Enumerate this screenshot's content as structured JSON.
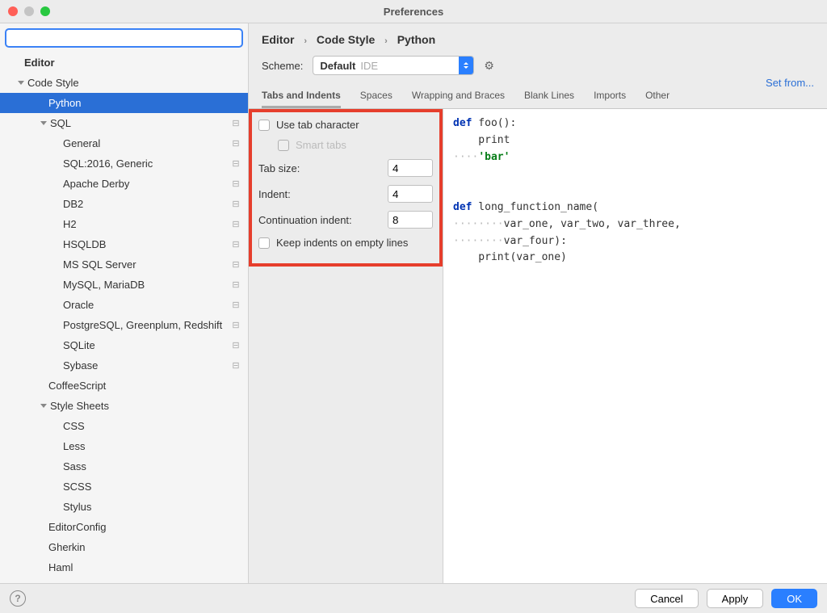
{
  "window": {
    "title": "Preferences"
  },
  "search": {
    "placeholder": ""
  },
  "tree": {
    "root": "Editor",
    "codestyle": "Code Style",
    "python": "Python",
    "sql": "SQL",
    "sql_items": [
      "General",
      "SQL:2016, Generic",
      "Apache Derby",
      "DB2",
      "H2",
      "HSQLDB",
      "MS SQL Server",
      "MySQL, MariaDB",
      "Oracle",
      "PostgreSQL, Greenplum, Redshift",
      "SQLite",
      "Sybase"
    ],
    "coffeescript": "CoffeeScript",
    "stylesheets": "Style Sheets",
    "style_items": [
      "CSS",
      "Less",
      "Sass",
      "SCSS",
      "Stylus"
    ],
    "editorconfig": "EditorConfig",
    "gherkin": "Gherkin",
    "haml": "Haml"
  },
  "breadcrumb": {
    "a": "Editor",
    "b": "Code Style",
    "c": "Python"
  },
  "scheme": {
    "label": "Scheme:",
    "value": "Default",
    "suffix": "IDE",
    "setfrom": "Set from..."
  },
  "tabs": [
    "Tabs and Indents",
    "Spaces",
    "Wrapping and Braces",
    "Blank Lines",
    "Imports",
    "Other"
  ],
  "settings": {
    "use_tab": "Use tab character",
    "smart_tabs": "Smart tabs",
    "tab_size_label": "Tab size:",
    "tab_size_val": "4",
    "indent_label": "Indent:",
    "indent_val": "4",
    "cont_label": "Continuation indent:",
    "cont_val": "8",
    "keep_indents": "Keep indents on empty lines"
  },
  "code": {
    "l1a": "def",
    "l1b": " foo():",
    "l2": "    print",
    "l3dots": "····",
    "l3str": "'bar'",
    "l4a": "def",
    "l4b": " long_function_name(",
    "l5dots": "········",
    "l5": "var_one, var_two, var_three,",
    "l6dots": "········",
    "l6": "var_four):",
    "l7": "    print(var_one)"
  },
  "footer": {
    "cancel": "Cancel",
    "apply": "Apply",
    "ok": "OK"
  }
}
